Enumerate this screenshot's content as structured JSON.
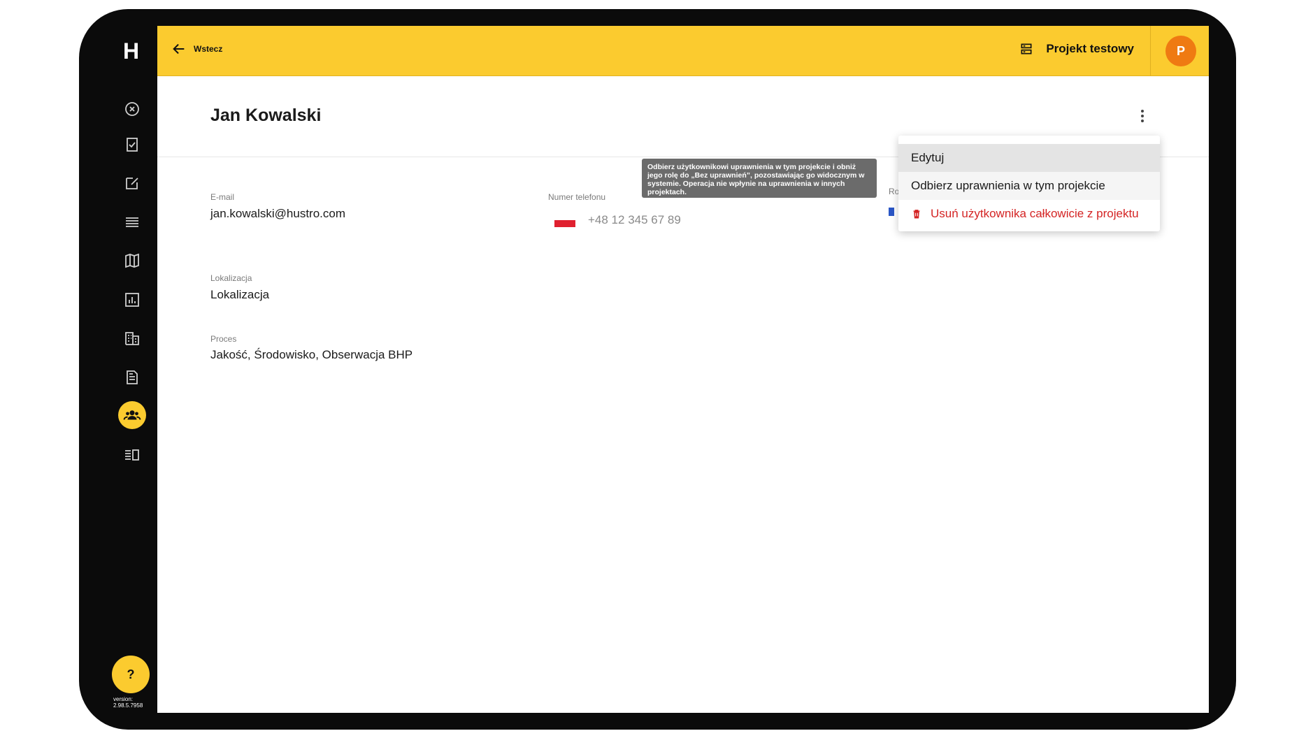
{
  "app": {
    "logo_text": "H",
    "version_label": "version:",
    "version_number": "2.98.5.7958"
  },
  "sidebar": {
    "items": [
      {
        "icon": "close-circle-icon"
      },
      {
        "icon": "checklist-icon"
      },
      {
        "icon": "edit-icon"
      },
      {
        "icon": "list-icon"
      },
      {
        "icon": "map-icon"
      },
      {
        "icon": "chart-icon"
      },
      {
        "icon": "building-icon"
      },
      {
        "icon": "document-icon"
      },
      {
        "icon": "users-icon",
        "active": true
      },
      {
        "icon": "sidebar-panel-icon"
      }
    ],
    "help_label": "?"
  },
  "topbar": {
    "back_label": "Wstecz",
    "project_label": "Projekt testowy",
    "avatar_initial": "P"
  },
  "user": {
    "name": "Jan Kowalski",
    "email_label": "E-mail",
    "email": "jan.kowalski@hustro.com",
    "phone_label": "Numer telefonu",
    "phone": "+48 12 345 67 89",
    "role_label_partial": "Ro",
    "location_label": "Lokalizacja",
    "location": "Lokalizacja",
    "process_label": "Proces",
    "process": "Jakość, Środowisko, Obserwacja BHP"
  },
  "tooltip": {
    "text": "Odbierz użytkownikowi uprawnienia w tym projekcie i obniż jego rolę do „Bez uprawnień”, pozostawiając go widocznym w systemie. Operacja nie wpłynie na uprawnienia w innych projektach."
  },
  "menu": {
    "edit_label": "Edytuj",
    "revoke_label": "Odbierz uprawnienia w tym projekcie",
    "delete_label": "Usuń użytkownika całkowicie z projektu"
  },
  "colors": {
    "accent": "#fbcb2f",
    "avatar": "#ef7a12",
    "danger": "#d42424",
    "frame": "#0b0b0b"
  }
}
